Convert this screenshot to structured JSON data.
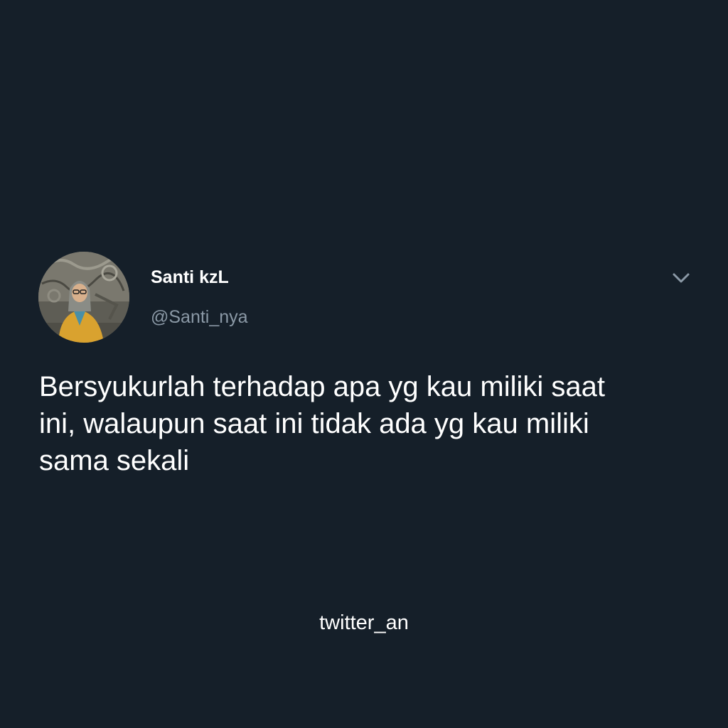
{
  "tweet": {
    "author": {
      "display_name": "Santi kzL",
      "handle": "@Santi_nya",
      "avatar": "profile-photo"
    },
    "menu_icon": "chevron-down-icon",
    "text_lines": [
      "Bersyukurlah terhadap apa yg kau miliki saat",
      "ini, walaupun saat ini tidak ada yg kau miliki",
      "sama sekali"
    ]
  },
  "watermark": "twitter_an",
  "colors": {
    "background": "#151f29",
    "text_primary": "#ffffff",
    "text_secondary": "#8b99a6"
  }
}
